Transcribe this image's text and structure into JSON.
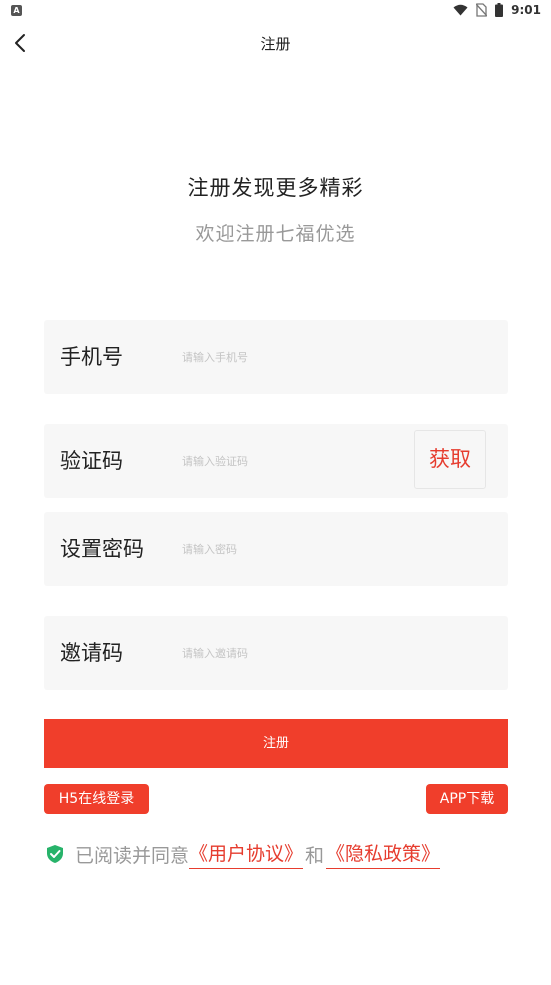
{
  "status_bar": {
    "time": "9:01",
    "notification_letter": "A",
    "icons": [
      "wifi-icon",
      "no-sim-icon",
      "battery-icon"
    ]
  },
  "nav": {
    "title": "注册",
    "back_icon": "chevron-left-icon"
  },
  "hero": {
    "headline": "注册发现更多精彩",
    "subheadline": "欢迎注册七福优选"
  },
  "form": {
    "phone": {
      "label": "手机号",
      "placeholder": "请输入手机号",
      "value": ""
    },
    "code": {
      "label": "验证码",
      "placeholder": "请输入验证码",
      "value": "",
      "get_button": "获取"
    },
    "password": {
      "label": "设置密码",
      "placeholder": "请输入密码",
      "value": ""
    },
    "invite": {
      "label": "邀请码",
      "placeholder": "请输入邀请码",
      "value": ""
    }
  },
  "register_button": "注册",
  "links": {
    "h5_login": "H5在线登录",
    "app_download": "APP下载"
  },
  "agreement": {
    "checked": true,
    "prefix": "已阅读并同意",
    "user_agreement": "《用户协议》",
    "and": "和",
    "privacy_policy": "《隐私政策》"
  },
  "colors": {
    "accent": "#f03e2b",
    "field_bg": "#f7f7f7",
    "muted_text": "#999999",
    "check": "#27b36a"
  }
}
